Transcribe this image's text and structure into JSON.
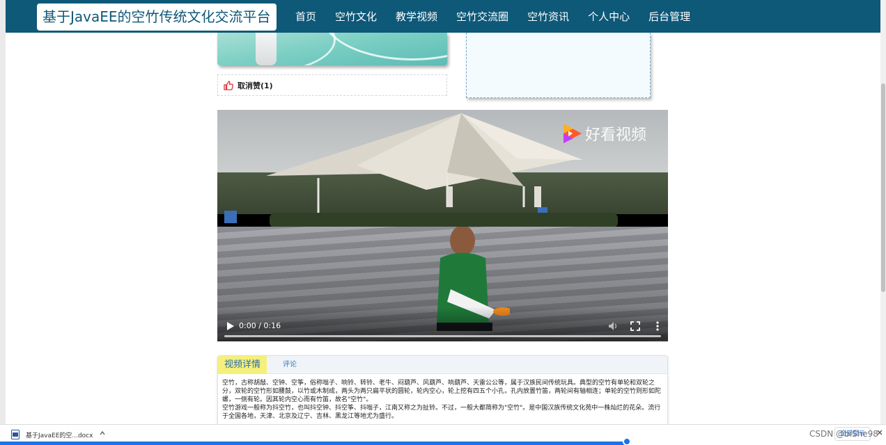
{
  "nav": {
    "brand": "基于JavaEE的空竹传统文化交流平台",
    "items": [
      {
        "label": "首页"
      },
      {
        "label": "空竹文化"
      },
      {
        "label": "教学视频"
      },
      {
        "label": "空竹交流圈"
      },
      {
        "label": "空竹资讯"
      },
      {
        "label": "个人中心"
      },
      {
        "label": "后台管理"
      }
    ]
  },
  "like": {
    "label": "取消赞(1)",
    "icon": "thumbs-up-icon",
    "icon_color": "#d9363e"
  },
  "video": {
    "watermark": "好看视频",
    "time": "0:00 / 0:16",
    "progress": 0.0
  },
  "tabs": {
    "active": "视频详情",
    "second": "评论"
  },
  "description": {
    "p1": "空竹，古称胡敲、空钟、空筝，俗称嗡子、响铃、转铃、老牛、闷葫芦、风葫芦、响葫芦、天雷公公等，属于汉族民间传统玩具。典型的空竹有单轮和双轮之分，双轮的空竹形如腰鼓，以竹或木制成，两头为两只扁平状的圆轮，轮内空心，轮上挖有四五个小孔，孔内放置竹笛，两轮间有轴相连；单轮的空竹则形如陀螺，一侧有轮。因其轮内空心而有竹笛，故名\"空竹\"。",
    "p2": "空竹游戏一般称为抖空竹，也叫抖空钟、抖空筝、抖嗡子，江南又称之为扯铃。不过，一般大都简称为\"空竹\"。是中国汉族传统文化苑中一株灿烂的花朵。流行于全国各地，天津、北京及辽宁、吉林、黑龙江等地尤为盛行。"
  },
  "download": {
    "filename": "基于JavaEE的空...docx",
    "show_all": "全部显示",
    "source": "CSDN @biShe98"
  },
  "colors": {
    "nav_bg": "#0e5878",
    "tab_active_bg": "#f5f07a",
    "accent": "#1a73e8"
  }
}
